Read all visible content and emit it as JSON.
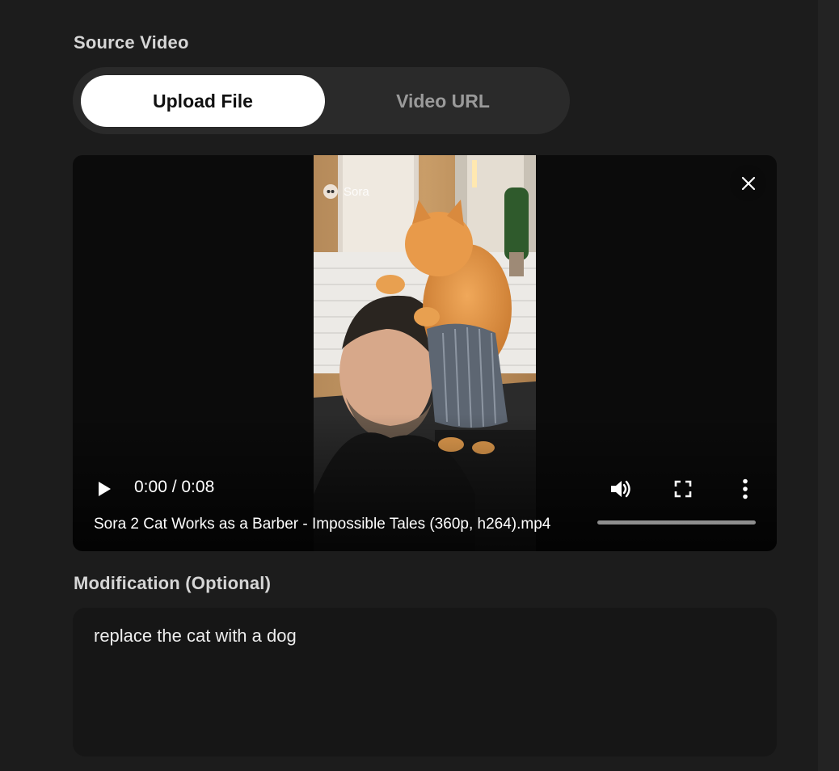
{
  "source_video": {
    "label": "Source Video",
    "tabs": [
      {
        "label": "Upload File",
        "active": true
      },
      {
        "label": "Video URL",
        "active": false
      }
    ]
  },
  "player": {
    "watermark": "Sora",
    "time_display": "0:00 / 0:08",
    "filename": "Sora 2 Cat Works as a Barber - Impossible Tales (360p, h264).mp4",
    "progress_fraction": 0,
    "icons": {
      "close": "close-icon",
      "play": "play-icon",
      "volume": "volume-icon",
      "fullscreen": "fullscreen-icon",
      "more": "more-vertical-icon"
    }
  },
  "modification": {
    "label": "Modification (Optional)",
    "value": "replace the cat with a dog"
  },
  "colors": {
    "background": "#1c1c1c",
    "toggle_track": "#2a2a2a",
    "toggle_active": "#ffffff",
    "player_bg": "#0b0b0b",
    "textarea_bg": "#161616"
  }
}
